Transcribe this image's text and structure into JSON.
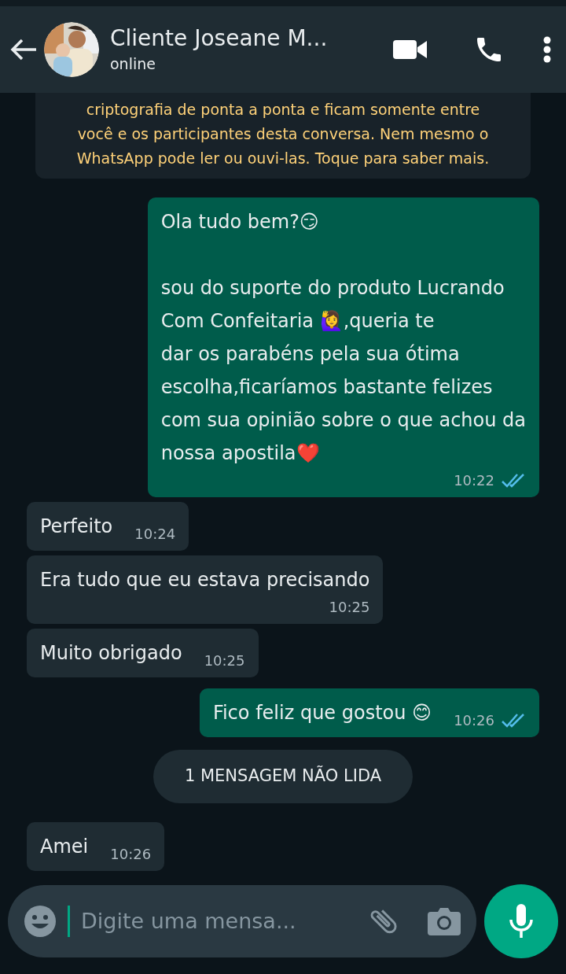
{
  "header": {
    "contact_name": "Cliente Joseane M...",
    "status": "online"
  },
  "encryption_notice": "criptografia de ponta a ponta e ficam somente entre\nvocê e os participantes desta conversa. Nem mesmo o\nWhatsApp pode ler ou ouvi-las. Toque para saber mais.",
  "messages": [
    {
      "kind": "message",
      "from_me": true,
      "text": "Ola tudo bem?😏\n\nsou do suporte do produto Lucrando\nCom Confeitaria 🙋‍♀️,queria te\ndar os parabéns pela sua ótima\nescolha,ficaríamos bastante felizes\ncom sua opinião sobre o que achou da\nnossa apostila❤️",
      "time": "10:22",
      "read": true
    },
    {
      "kind": "message",
      "from_me": false,
      "text": "Perfeito",
      "time": "10:24"
    },
    {
      "kind": "message",
      "from_me": false,
      "text": "Era tudo que eu estava precisando",
      "time": "10:25"
    },
    {
      "kind": "message",
      "from_me": false,
      "text": "Muito obrigado",
      "time": "10:25"
    },
    {
      "kind": "message",
      "from_me": true,
      "text": "Fico feliz que gostou 😊",
      "time": "10:26",
      "read": true
    },
    {
      "kind": "divider",
      "text": "1 MENSAGEM NÃO LIDA"
    },
    {
      "kind": "message",
      "from_me": false,
      "text": "Amei",
      "time": "10:26"
    }
  ],
  "composer": {
    "placeholder": "Digite uma mensa..."
  }
}
